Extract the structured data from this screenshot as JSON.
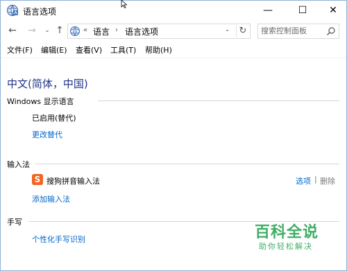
{
  "window": {
    "title": "语言选项",
    "controls": {
      "minimize": "—",
      "maximize": "☐",
      "close": "✕"
    }
  },
  "nav": {
    "back": "←",
    "forward": "→",
    "recent": "⌄",
    "up": "↑",
    "breadcrumb": {
      "prefix": "«",
      "part1": "语言",
      "sep": "›",
      "part2": "语言选项"
    },
    "dropdown": "⌄",
    "refresh": "↻",
    "search_placeholder": "搜索控制面板"
  },
  "menu": {
    "file": "文件(F)",
    "edit": "编辑(E)",
    "view": "查看(V)",
    "tools": "工具(T)",
    "help": "帮助(H)"
  },
  "content": {
    "language_title": "中文(简体，中国)",
    "display_language": {
      "label": "Windows 显示语言",
      "status": "已启用(替代)",
      "link": "更改替代"
    },
    "input_method": {
      "label": "输入法",
      "ime_name": "搜狗拼音输入法",
      "ime_icon": "S",
      "options_link": "选项",
      "separator": "|",
      "remove_link": "删除",
      "add_link": "添加输入法"
    },
    "handwriting": {
      "label": "手写",
      "link": "个性化手写识别"
    }
  },
  "watermark": {
    "main": "百科全说",
    "sub": "助你轻松解决"
  },
  "colors": {
    "heading": "#1e3287",
    "link": "#0066cc",
    "watermark": "#3fae64",
    "sogou": "#f26522"
  }
}
